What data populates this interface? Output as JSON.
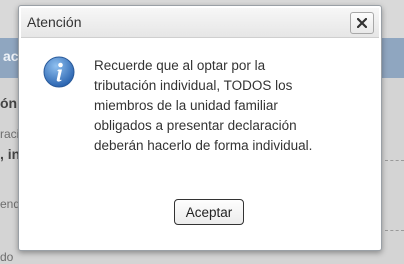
{
  "background": {
    "header_fragment": "aci",
    "text_fragments": [
      "ón c",
      "raci",
      ", in",
      "endi",
      "do"
    ]
  },
  "dialog": {
    "title": "Atención",
    "close_icon": "close-x-icon",
    "info_icon": "info-circle-icon",
    "message": "Recuerde que al optar por la\ntributación individual, TODOS los\nmiembros de la unidad familiar\nobligados a presentar declaración\ndeberán hacerlo de forma individual.",
    "ok_label": "Aceptar"
  },
  "colors": {
    "info_icon_blue": "#3b78c2",
    "overlay_header": "#8fa6c0"
  }
}
